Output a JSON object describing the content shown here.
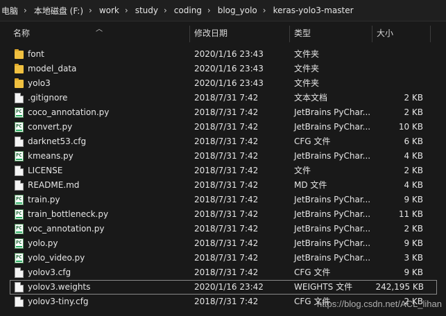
{
  "breadcrumb": [
    "电脑",
    "本地磁盘 (F:)",
    "work",
    "study",
    "coding",
    "blog_yolo",
    "keras-yolo3-master"
  ],
  "columns": {
    "name": "名称",
    "date": "修改日期",
    "type": "类型",
    "size": "大小"
  },
  "files": [
    {
      "name": "font",
      "date": "2020/1/16 23:43",
      "type": "文件夹",
      "size": "",
      "icon": "folder-icon"
    },
    {
      "name": "model_data",
      "date": "2020/1/16 23:43",
      "type": "文件夹",
      "size": "",
      "icon": "folder-icon"
    },
    {
      "name": "yolo3",
      "date": "2020/1/16 23:43",
      "type": "文件夹",
      "size": "",
      "icon": "folder-icon"
    },
    {
      "name": ".gitignore",
      "date": "2018/7/31 7:42",
      "type": "文本文档",
      "size": "2 KB",
      "icon": "text-file-icon"
    },
    {
      "name": "coco_annotation.py",
      "date": "2018/7/31 7:42",
      "type": "JetBrains PyChar...",
      "size": "2 KB",
      "icon": "pycharm-file-icon"
    },
    {
      "name": "convert.py",
      "date": "2018/7/31 7:42",
      "type": "JetBrains PyChar...",
      "size": "10 KB",
      "icon": "pycharm-file-icon"
    },
    {
      "name": "darknet53.cfg",
      "date": "2018/7/31 7:42",
      "type": "CFG 文件",
      "size": "6 KB",
      "icon": "file-icon"
    },
    {
      "name": "kmeans.py",
      "date": "2018/7/31 7:42",
      "type": "JetBrains PyChar...",
      "size": "4 KB",
      "icon": "pycharm-file-icon"
    },
    {
      "name": "LICENSE",
      "date": "2018/7/31 7:42",
      "type": "文件",
      "size": "2 KB",
      "icon": "file-icon"
    },
    {
      "name": "README.md",
      "date": "2018/7/31 7:42",
      "type": "MD 文件",
      "size": "4 KB",
      "icon": "file-icon"
    },
    {
      "name": "train.py",
      "date": "2018/7/31 7:42",
      "type": "JetBrains PyChar...",
      "size": "9 KB",
      "icon": "pycharm-file-icon"
    },
    {
      "name": "train_bottleneck.py",
      "date": "2018/7/31 7:42",
      "type": "JetBrains PyChar...",
      "size": "11 KB",
      "icon": "pycharm-file-icon"
    },
    {
      "name": "voc_annotation.py",
      "date": "2018/7/31 7:42",
      "type": "JetBrains PyChar...",
      "size": "2 KB",
      "icon": "pycharm-file-icon"
    },
    {
      "name": "yolo.py",
      "date": "2018/7/31 7:42",
      "type": "JetBrains PyChar...",
      "size": "9 KB",
      "icon": "pycharm-file-icon"
    },
    {
      "name": "yolo_video.py",
      "date": "2018/7/31 7:42",
      "type": "JetBrains PyChar...",
      "size": "3 KB",
      "icon": "pycharm-file-icon"
    },
    {
      "name": "yolov3.cfg",
      "date": "2018/7/31 7:42",
      "type": "CFG 文件",
      "size": "9 KB",
      "icon": "file-icon"
    },
    {
      "name": "yolov3.weights",
      "date": "2020/1/16 23:42",
      "type": "WEIGHTS 文件",
      "size": "242,195 KB",
      "icon": "file-icon",
      "selected": true
    },
    {
      "name": "yolov3-tiny.cfg",
      "date": "2018/7/31 7:42",
      "type": "CFG 文件",
      "size": "2 KB",
      "icon": "file-icon"
    }
  ],
  "watermark": "https://blog.csdn.net/ACL_lihan",
  "colors": {
    "background": "#191919",
    "folder": "#f0c040",
    "text": "#e6e6e6"
  }
}
